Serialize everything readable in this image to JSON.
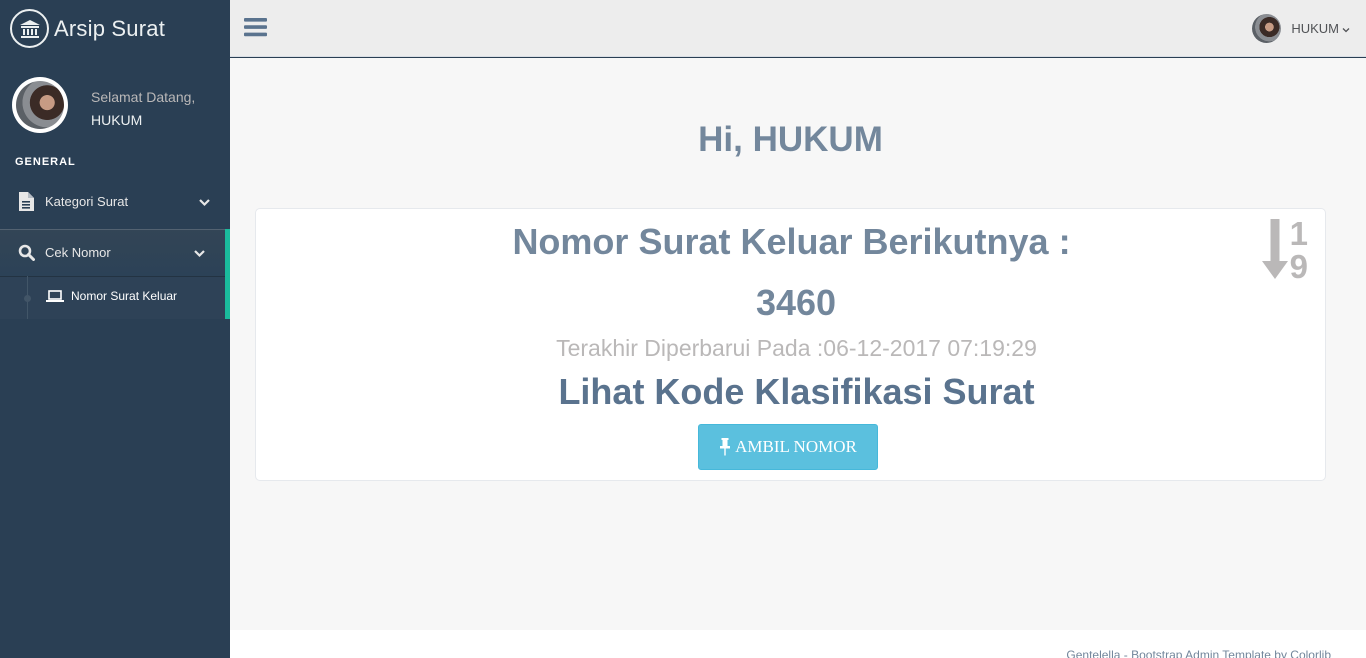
{
  "sidebar": {
    "brand": {
      "title": "Arsip Surat",
      "icon": "bank-icon"
    },
    "profile": {
      "welcome": "Selamat Datang,",
      "name": "HUKUM"
    },
    "section_title": "GENERAL",
    "items": [
      {
        "label": "Kategori Surat",
        "icon": "file-text-icon",
        "expanded": false
      },
      {
        "label": "Cek Nomor",
        "icon": "search-icon",
        "expanded": true,
        "children": [
          {
            "label": "Nomor Surat Keluar",
            "icon": "laptop-icon"
          }
        ]
      }
    ],
    "active_accent": "#1abb9c"
  },
  "topnav": {
    "user_name": "HUKUM"
  },
  "main": {
    "greeting": "Hi, HUKUM",
    "tile": {
      "heading": "Nomor Surat Keluar Berikutnya :",
      "next_number": "3460",
      "updated_label": "Terakhir Diperbarui Pada :",
      "updated_value": "06-12-2017 07:19:29",
      "link_label": "Lihat Kode Klasifikasi Surat",
      "button_label": "AMBIL NOMOR",
      "sort_icon_digit_top": "1",
      "sort_icon_digit_bottom": "9"
    }
  },
  "footer": {
    "text": "Gentelella - Bootstrap Admin Template by Colorlib"
  },
  "colors": {
    "sidebar_bg": "#2a3f54",
    "main_bg": "#f7f7f7",
    "text_primary": "#73879c",
    "button_info": "#5bc0de"
  }
}
